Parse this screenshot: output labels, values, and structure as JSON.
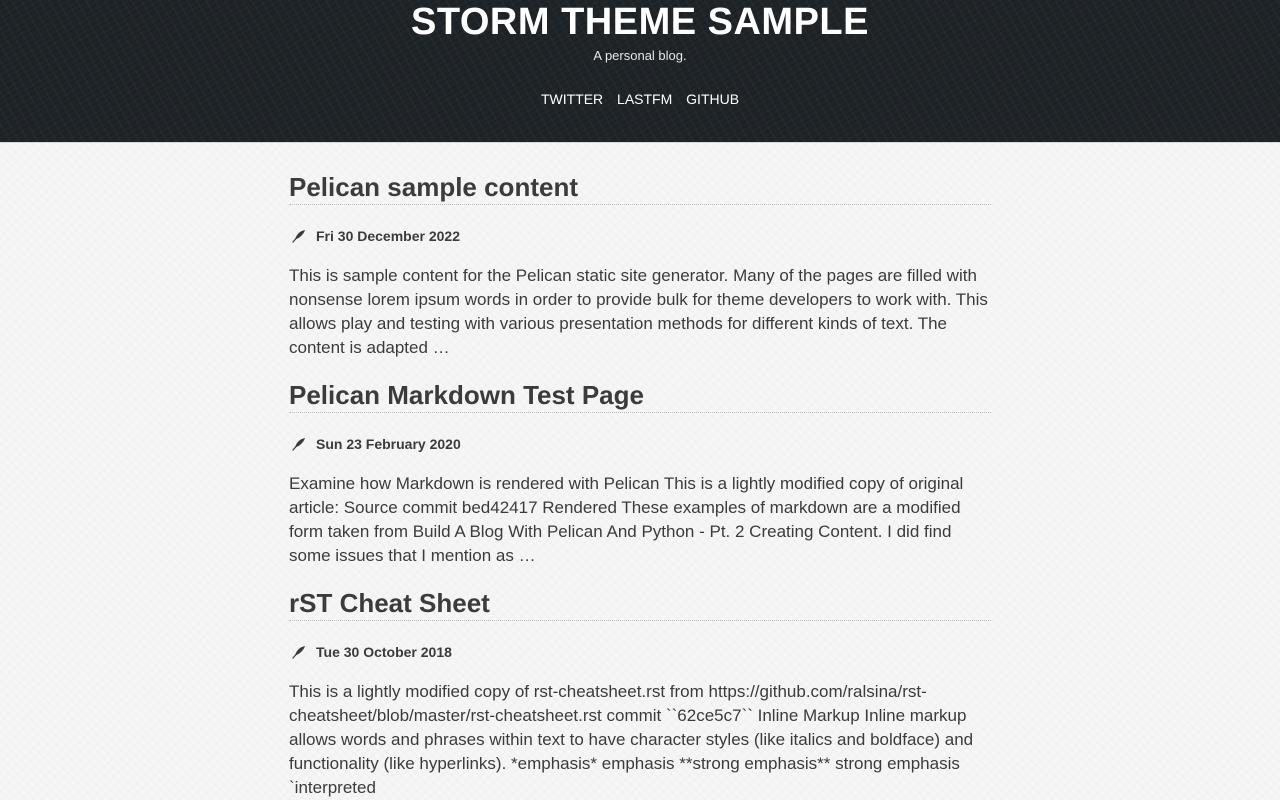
{
  "site": {
    "title": "STORM THEME SAMPLE",
    "tagline": "A personal blog."
  },
  "nav": {
    "items": [
      {
        "label": "TWITTER"
      },
      {
        "label": "LASTFM"
      },
      {
        "label": "GITHUB"
      }
    ]
  },
  "posts": [
    {
      "title": "Pelican sample content",
      "date": "Fri 30 December 2022",
      "icon": "quill-icon",
      "summary": "This is sample content for the Pelican static site generator. Many of the pages are filled with nonsense lorem ipsum words in order to provide bulk for theme developers to work with. This allows play and testing with various presentation methods for different kinds of text. The content is adapted …"
    },
    {
      "title": "Pelican Markdown Test Page",
      "date": "Sun 23 February 2020",
      "icon": "quill-icon",
      "summary": "Examine how Markdown is rendered with Pelican This is a lightly modified copy of original article: Source commit bed42417 Rendered These examples of markdown are a modified form taken from Build A Blog With Pelican And Python - Pt. 2 Creating Content. I did find some issues that I mention as …"
    },
    {
      "title": "rST Cheat Sheet",
      "date": "Tue 30 October 2018",
      "icon": "quill-icon",
      "summary": "This is a lightly modified copy of rst-cheatsheet.rst from https://github.com/ralsina/rst-cheatsheet/blob/master/rst-cheatsheet.rst commit ``62ce5c7`` Inline Markup Inline markup allows words and phrases within text to have character styles (like italics and boldface) and functionality (like hyperlinks). *emphasis* emphasis **strong emphasis** strong emphasis `interpreted"
    }
  ],
  "colors": {
    "header_bg": "#1f2428",
    "page_bg": "#f6f6f6",
    "text": "#3b3b3b",
    "header_text": "#ffffff"
  }
}
